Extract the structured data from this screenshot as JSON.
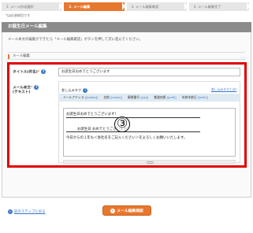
{
  "steps": [
    {
      "label": "1. メール作成選択"
    },
    {
      "label": "2. メール編集"
    },
    {
      "label": "3. メール編集確認"
    },
    {
      "label": "4. メール編集完了"
    }
  ],
  "required_note": "*は必須項目です",
  "panel": {
    "title": "お誕生日メール編集",
    "description": "メール本文の編集ができたら「メール編集確認」ボタンを押して次に進んでください。",
    "section_label": "メール編集"
  },
  "form": {
    "title_label": "タイトル(件名)",
    "title_value": "お誕生日おめでとうございます",
    "body_label_1": "メール本文",
    "body_label_2": "(テキスト)",
    "help_glyph": "?",
    "required_mark": "*",
    "tag_label": "差し込みタグ",
    "tag_link": "差し込みタグとは?",
    "tags": [
      {
        "name": "メールアドレス",
        "code": "[[mailad]]"
      },
      {
        "name": "名前",
        "code": "[[name]]"
      },
      {
        "name": "郵便番号",
        "code": "[[zip]]"
      },
      {
        "name": "都道府県",
        "code": "[[pref]]"
      },
      {
        "name": "年齢年齢日",
        "code": "[[birth]]"
      }
    ],
    "editor_lines": [
      "お誕生日おめでとうございます！",
      "お誕生日 おめでとうございます！",
      "今日からの１年も＜会社名をご記入ください＞をよろしくお願いいたします。"
    ]
  },
  "callout_number": "③",
  "footer": {
    "back_label": "前のステップに戻る",
    "back_glyph": "«",
    "confirm_label": "メール編集確認",
    "confirm_glyph": "»"
  }
}
